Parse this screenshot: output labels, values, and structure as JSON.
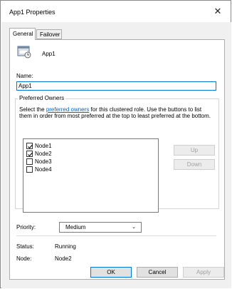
{
  "window": {
    "title": "App1 Properties",
    "close_glyph": "✕"
  },
  "tabs": [
    {
      "label": "General",
      "active": true
    },
    {
      "label": "Failover",
      "active": false
    }
  ],
  "general": {
    "app_icon": "clustered-role-icon",
    "app_name": "App1",
    "name_label": "Name:",
    "name_value": "App1",
    "preferred_owners": {
      "title": "Preferred Owners",
      "desc_before_link": "Select the ",
      "desc_link": "preferred owners",
      "desc_after_link": " for this clustered role. Use the buttons to list them in order from most preferred at the top to least preferred at the bottom.",
      "nodes": [
        {
          "label": "Node1",
          "checked": true
        },
        {
          "label": "Node2",
          "checked": true
        },
        {
          "label": "Node3",
          "checked": false
        },
        {
          "label": "Node4",
          "checked": false
        }
      ],
      "up_button": "Up",
      "down_button": "Down"
    },
    "priority_label": "Priority:",
    "priority_value": "Medium",
    "status_label": "Status:",
    "status_value": "Running",
    "node_label": "Node:",
    "node_value": "Node2"
  },
  "footer": {
    "ok": "OK",
    "cancel": "Cancel",
    "apply": "Apply"
  },
  "colors": {
    "link": "#0066cc",
    "focus_border": "#0078d7",
    "dialog_bg": "#f0f0f0"
  }
}
